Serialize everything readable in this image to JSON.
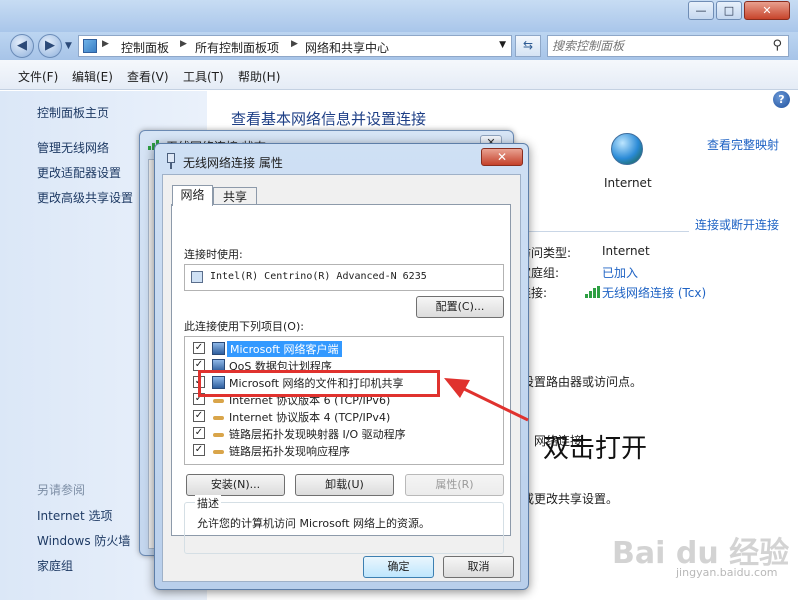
{
  "window": {
    "minimize": "—",
    "maximize": "□",
    "close": "✕"
  },
  "address": {
    "crumbs": [
      "控制面板",
      "所有控制面板项",
      "网络和共享中心"
    ],
    "search_placeholder": "搜索控制面板"
  },
  "menu": [
    "文件(F)",
    "编辑(E)",
    "查看(V)",
    "工具(T)",
    "帮助(H)"
  ],
  "left_pane": {
    "home": "控制面板主页",
    "links": [
      "管理无线网络",
      "更改适配器设置",
      "更改高级共享设置"
    ],
    "see_also_title": "另请参阅",
    "see_also": [
      "Internet 选项",
      "Windows 防火墙",
      "家庭组"
    ]
  },
  "main": {
    "heading": "查看基本网络信息并设置连接",
    "view_full_map": "查看完整映射",
    "internet_label": "Internet",
    "connect_disconnect": "连接或断开连接",
    "access_type_label": "访问类型:",
    "access_type_value": "Internet",
    "homegroup_label": "家庭组:",
    "homegroup_value": "已加入",
    "connections_label": "连接:",
    "connections_value": "无线网络连接 (Tcx)",
    "router_fragment": "设置路由器或访问点。",
    "network_fragment": "网络连接",
    "sharing_fragment": "或更改共享设置。"
  },
  "status_window": {
    "title": "无线网络连接 状态",
    "close": "✕"
  },
  "dialog": {
    "title": "无线网络连接 属性",
    "close": "✕",
    "tabs": [
      "网络",
      "共享"
    ],
    "connect_using_label": "连接时使用:",
    "adapter_name": "Intel(R) Centrino(R) Advanced-N 6235",
    "configure_button": "配置(C)...",
    "items_label": "此连接使用下列项目(O):",
    "items": [
      {
        "label": "Microsoft 网络客户端",
        "checked": true,
        "icon": "network-client-icon",
        "selected": true
      },
      {
        "label": "QoS 数据包计划程序",
        "checked": true,
        "icon": "qos-icon",
        "selected": false
      },
      {
        "label": "Microsoft 网络的文件和打印机共享",
        "checked": true,
        "icon": "file-printer-sharing-icon",
        "selected": false
      },
      {
        "label": "Internet 协议版本 6 (TCP/IPv6)",
        "checked": true,
        "icon": "protocol-icon",
        "selected": false
      },
      {
        "label": "Internet 协议版本 4 (TCP/IPv4)",
        "checked": true,
        "icon": "protocol-icon",
        "selected": false
      },
      {
        "label": "链路层拓扑发现映射器 I/O 驱动程序",
        "checked": true,
        "icon": "protocol-icon",
        "selected": false
      },
      {
        "label": "链路层拓扑发现响应程序",
        "checked": true,
        "icon": "protocol-icon",
        "selected": false
      }
    ],
    "install_button": "安装(N)...",
    "uninstall_button": "卸载(U)",
    "properties_button": "属性(R)",
    "description_label": "描述",
    "description_text": "允许您的计算机访问 Microsoft 网络上的资源。",
    "ok_button": "确定",
    "cancel_button": "取消"
  },
  "annotation": {
    "instruction": "双击打开",
    "highlight_color": "#e0322e"
  },
  "watermark": {
    "brand": "Bai du 经验",
    "url": "jingyan.baidu.com"
  },
  "colors": {
    "link": "#1f63c4",
    "heading": "#1e3f86",
    "selection": "#3399ff"
  }
}
